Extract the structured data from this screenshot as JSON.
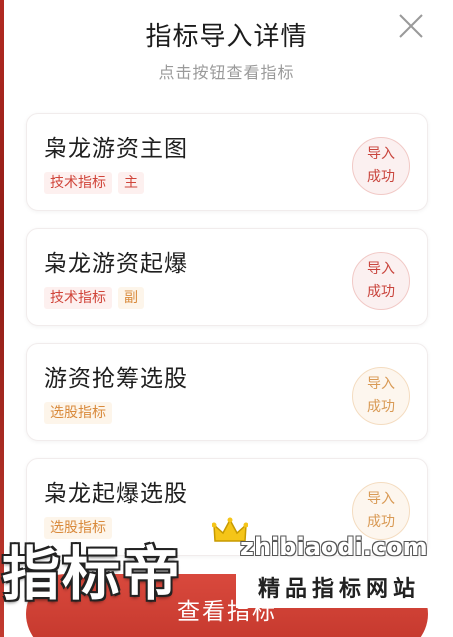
{
  "header": {
    "title": "指标导入详情",
    "subtitle": "点击按钮查看指标",
    "close_icon": "close-icon"
  },
  "indicators": [
    {
      "name": "枭龙游资主图",
      "tags": [
        {
          "text": "技术指标",
          "color": "red"
        },
        {
          "text": "主",
          "color": "red"
        }
      ],
      "status_line1": "导入",
      "status_line2": "成功",
      "status_color": "red"
    },
    {
      "name": "枭龙游资起爆",
      "tags": [
        {
          "text": "技术指标",
          "color": "red"
        },
        {
          "text": "副",
          "color": "orange"
        }
      ],
      "status_line1": "导入",
      "status_line2": "成功",
      "status_color": "red"
    },
    {
      "name": "游资抢筹选股",
      "tags": [
        {
          "text": "选股指标",
          "color": "orange"
        }
      ],
      "status_line1": "导入",
      "status_line2": "成功",
      "status_color": "orange"
    },
    {
      "name": "枭龙起爆选股",
      "tags": [
        {
          "text": "选股指标",
          "color": "orange"
        }
      ],
      "status_line1": "导入",
      "status_line2": "成功",
      "status_color": "orange"
    }
  ],
  "footer": {
    "view_button_label": "查看指标"
  },
  "watermark": {
    "brand": "指标帝",
    "url": "zhibiaodi.com",
    "slogan": "精品指标网站"
  },
  "colors": {
    "accent_red": "#c9453d",
    "accent_orange": "#d99a55",
    "button_red": "#d9493d"
  }
}
